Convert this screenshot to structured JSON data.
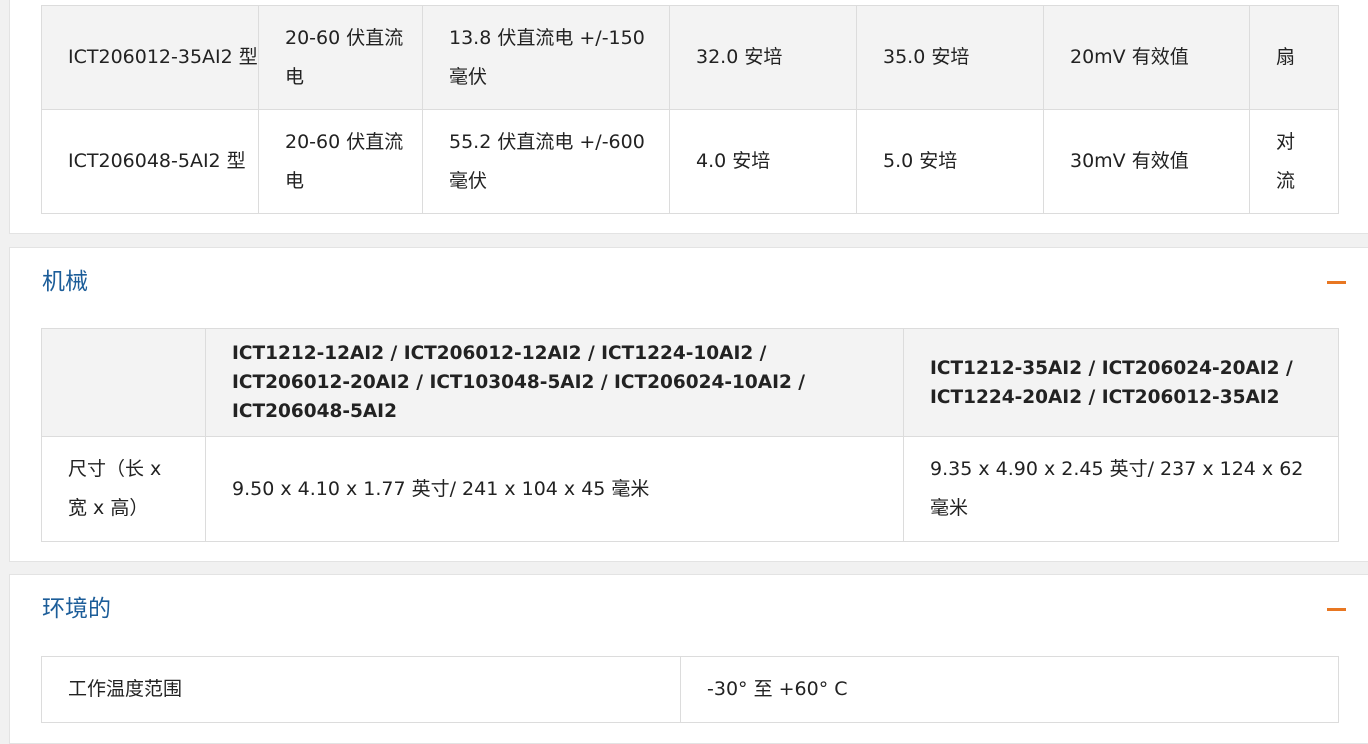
{
  "electrical_table": {
    "rows": [
      [
        "ICT206012-35AI2 型",
        "20-60 伏直流电",
        "13.8 伏直流电 +/-150 毫伏",
        "32.0 安培",
        "35.0 安培",
        "20mV 有效值",
        "扇"
      ],
      [
        "ICT206048-5AI2 型",
        "20-60 伏直流电",
        "55.2 伏直流电 +/-600 毫伏",
        "4.0 安培",
        "5.0 安培",
        "30mV 有效值",
        "对流"
      ]
    ]
  },
  "mechanical": {
    "title": "机械",
    "header": [
      "",
      "ICT1212-12AI2 / ICT206012-12AI2 / ICT1224-10AI2 / ICT206012-20AI2 / ICT103048-5AI2 / ICT206024-10AI2 / ICT206048-5AI2",
      "ICT1212-35AI2 / ICT206024-20AI2 / ICT1224-20AI2 / ICT206012-35AI2"
    ],
    "rows": [
      [
        "尺寸（长 x 宽 x 高）",
        "9.50 x 4.10 x 1.77 英寸/ 241 x 104 x 45 毫米",
        "9.35 x 4.90 x 2.45 英寸/ 237 x 124 x 62 毫米"
      ]
    ]
  },
  "environmental": {
    "title": "环境的",
    "rows": [
      [
        "工作温度范围",
        "-30° 至 +60° C"
      ]
    ]
  },
  "colors": {
    "section_title": "#1c5d99",
    "collapse_icon": "#e87722",
    "row_shade": "#f3f3f3"
  },
  "icons": [
    "collapse-minus-icon"
  ]
}
